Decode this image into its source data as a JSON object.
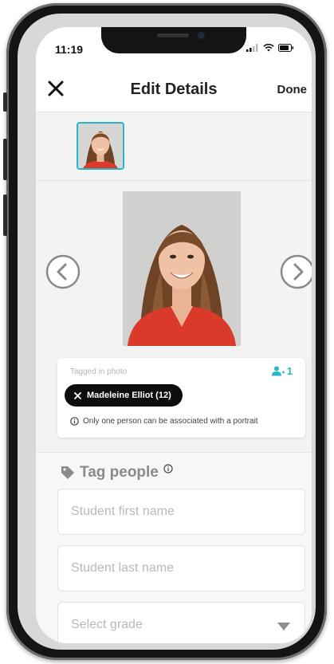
{
  "status_bar": {
    "time": "11:19"
  },
  "header": {
    "title": "Edit Details",
    "done_label": "Done"
  },
  "tag_card": {
    "tagged_label": "Tagged in photo",
    "person_count": "1",
    "chip_label": "Madeleine Elliot (12)",
    "note": "Only one person can be associated with a portrait"
  },
  "tag_section": {
    "heading": "Tag people",
    "first_name_placeholder": "Student first name",
    "last_name_placeholder": "Student last name",
    "grade_placeholder": "Select grade"
  },
  "colors": {
    "accent": "#27b6c9",
    "chip_bg": "#0d0d0d",
    "header_text": "#222222",
    "muted": "#8a8a8a"
  },
  "icons": [
    "close-icon",
    "chevron-left-icon",
    "chevron-right-icon",
    "person-icon",
    "info-icon",
    "tag-icon",
    "caret-down-icon",
    "signal-icon",
    "wifi-icon",
    "battery-icon"
  ]
}
